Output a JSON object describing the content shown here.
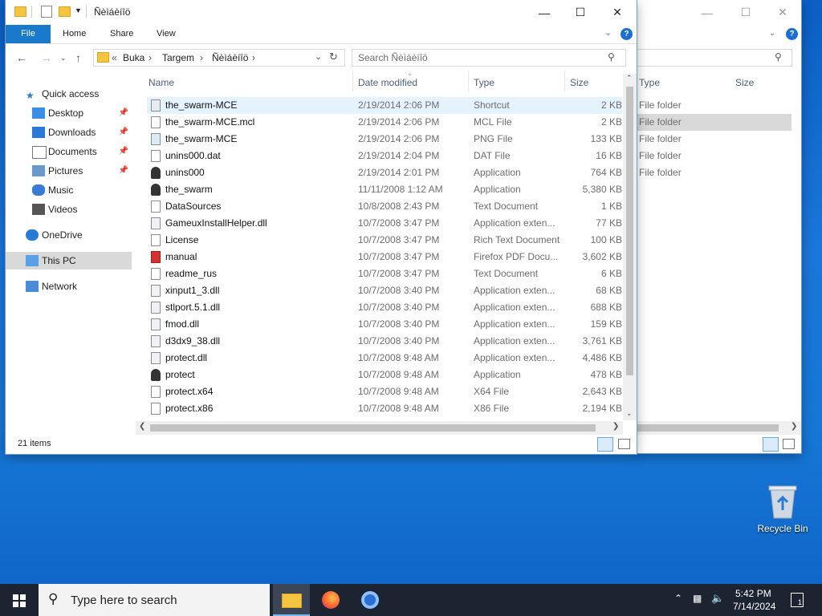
{
  "main_window": {
    "title": "Ñèìáèíîö",
    "tabs": [
      "File",
      "Home",
      "Share",
      "View"
    ],
    "breadcrumb": [
      "«",
      "Buka",
      "›",
      "Targem",
      "›",
      "Ñèìáèíîö",
      "›"
    ],
    "search_placeholder": "Search Ñèìáèíîö",
    "columns": {
      "name": "Name",
      "date": "Date modified",
      "type": "Type",
      "size": "Size"
    },
    "sidebar": [
      {
        "label": "Quick access",
        "icon": "star-icon",
        "pinned": false
      },
      {
        "label": "Desktop",
        "icon": "desktop-icon",
        "pinned": true
      },
      {
        "label": "Downloads",
        "icon": "download-icon",
        "pinned": true
      },
      {
        "label": "Documents",
        "icon": "documents-icon",
        "pinned": true
      },
      {
        "label": "Pictures",
        "icon": "pictures-icon",
        "pinned": true
      },
      {
        "label": "Music",
        "icon": "music-icon",
        "pinned": false
      },
      {
        "label": "Videos",
        "icon": "videos-icon",
        "pinned": false
      },
      {
        "label": "OneDrive",
        "icon": "cloud-icon",
        "pinned": false
      },
      {
        "label": "This PC",
        "icon": "computer-icon",
        "pinned": false
      },
      {
        "label": "Network",
        "icon": "network-icon",
        "pinned": false
      }
    ],
    "files": [
      {
        "name": "the_swarm-MCE",
        "date": "2/19/2014 2:06 PM",
        "type": "Shortcut",
        "size": "2 KB",
        "icon": "shortcut-icon"
      },
      {
        "name": "the_swarm-MCE.mcl",
        "date": "2/19/2014 2:06 PM",
        "type": "MCL File",
        "size": "2 KB",
        "icon": "file-icon"
      },
      {
        "name": "the_swarm-MCE",
        "date": "2/19/2014 2:06 PM",
        "type": "PNG File",
        "size": "133 KB",
        "icon": "image-file-icon"
      },
      {
        "name": "unins000.dat",
        "date": "2/19/2014 2:04 PM",
        "type": "DAT File",
        "size": "16 KB",
        "icon": "file-icon"
      },
      {
        "name": "unins000",
        "date": "2/19/2014 2:01 PM",
        "type": "Application",
        "size": "764 KB",
        "icon": "app-icon"
      },
      {
        "name": "the_swarm",
        "date": "11/11/2008 1:12 AM",
        "type": "Application",
        "size": "5,380 KB",
        "icon": "app-icon"
      },
      {
        "name": "DataSources",
        "date": "10/8/2008 2:43 PM",
        "type": "Text Document",
        "size": "1 KB",
        "icon": "text-file-icon"
      },
      {
        "name": "GameuxInstallHelper.dll",
        "date": "10/7/2008 3:47 PM",
        "type": "Application exten...",
        "size": "77 KB",
        "icon": "dll-icon"
      },
      {
        "name": "License",
        "date": "10/7/2008 3:47 PM",
        "type": "Rich Text Document",
        "size": "100 KB",
        "icon": "text-file-icon"
      },
      {
        "name": "manual",
        "date": "10/7/2008 3:47 PM",
        "type": "Firefox PDF Docu...",
        "size": "3,602 KB",
        "icon": "pdf-icon"
      },
      {
        "name": "readme_rus",
        "date": "10/7/2008 3:47 PM",
        "type": "Text Document",
        "size": "6 KB",
        "icon": "text-file-icon"
      },
      {
        "name": "xinput1_3.dll",
        "date": "10/7/2008 3:40 PM",
        "type": "Application exten...",
        "size": "68 KB",
        "icon": "dll-icon"
      },
      {
        "name": "stlport.5.1.dll",
        "date": "10/7/2008 3:40 PM",
        "type": "Application exten...",
        "size": "688 KB",
        "icon": "dll-icon"
      },
      {
        "name": "fmod.dll",
        "date": "10/7/2008 3:40 PM",
        "type": "Application exten...",
        "size": "159 KB",
        "icon": "dll-icon"
      },
      {
        "name": "d3dx9_38.dll",
        "date": "10/7/2008 3:40 PM",
        "type": "Application exten...",
        "size": "3,761 KB",
        "icon": "dll-icon"
      },
      {
        "name": "protect.dll",
        "date": "10/7/2008 9:48 AM",
        "type": "Application exten...",
        "size": "4,486 KB",
        "icon": "dll-icon"
      },
      {
        "name": "protect",
        "date": "10/7/2008 9:48 AM",
        "type": "Application",
        "size": "478 KB",
        "icon": "app-icon"
      },
      {
        "name": "protect.x64",
        "date": "10/7/2008 9:48 AM",
        "type": "X64 File",
        "size": "2,643 KB",
        "icon": "file-icon"
      },
      {
        "name": "protect.x86",
        "date": "10/7/2008 9:48 AM",
        "type": "X86 File",
        "size": "2,194 KB",
        "icon": "file-icon"
      }
    ],
    "status": "21 items"
  },
  "back_window": {
    "columns": {
      "type": "Type",
      "size": "Size"
    },
    "rows": [
      "File folder",
      "File folder",
      "File folder",
      "File folder",
      "File folder"
    ]
  },
  "desktop": {
    "recycle_bin": "Recycle Bin"
  },
  "taskbar": {
    "search_placeholder": "Type here to search",
    "time": "5:42 PM",
    "date": "7/14/2024",
    "notifications": "1"
  },
  "colors": {
    "accent": "#1979ca",
    "taskbar": "#1c2432",
    "hover": "#e5f3ff"
  }
}
